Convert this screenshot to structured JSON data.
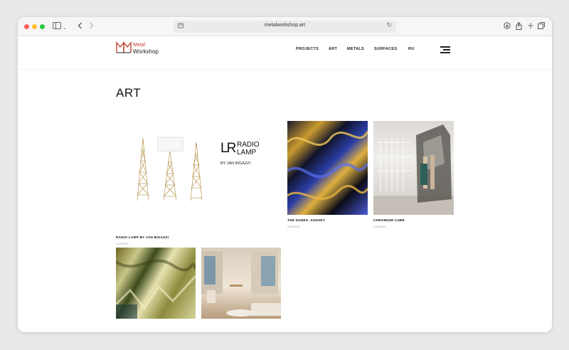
{
  "browser": {
    "url": "metalworkshop.art",
    "icons": [
      "sidebar-icon",
      "chevron-down-icon",
      "back-icon",
      "forward-icon",
      "site-icon",
      "reload-icon",
      "download-icon",
      "share-icon",
      "new-tab-icon",
      "tabs-icon"
    ]
  },
  "logo": {
    "line1": "Metal",
    "line2": "Workshop",
    "accent": "#c0392b"
  },
  "nav": {
    "projects": "PROJECTS",
    "art": "ART",
    "metals": "METALS",
    "surfaces": "SURFACES",
    "lang": "RU"
  },
  "page": {
    "title": "ART"
  },
  "cards": [
    {
      "title": "RADIO LAMP BY JAN BIGAZZI",
      "subtitle": "Contract",
      "brand_lr": "LR",
      "brand_name_1": "RADIO",
      "brand_name_2": "LAMP",
      "brand_by": "BY JAN BIGAZZI"
    },
    {
      "title": "THE DUNES. SUNSET.",
      "subtitle": "Contract"
    },
    {
      "title": "CHROMIUM CUBE",
      "subtitle": "Contract"
    },
    {
      "title": "",
      "subtitle": ""
    },
    {
      "title": "",
      "subtitle": ""
    }
  ]
}
